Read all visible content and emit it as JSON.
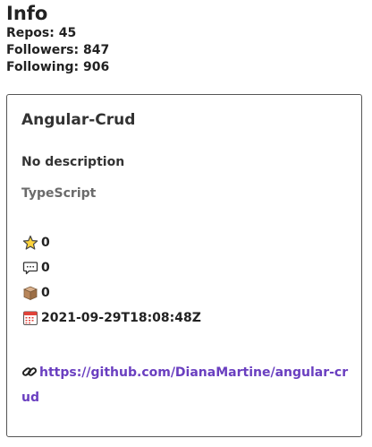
{
  "info": {
    "title": "Info",
    "repos": "Repos: 45",
    "followers": "Followers: 847",
    "following": "Following: 906"
  },
  "repo": {
    "name": "Angular-Crud",
    "description": "No description",
    "language": "TypeScript",
    "stars": "0",
    "comments": "0",
    "forks": "0",
    "updated": "2021-09-29T18:08:48Z",
    "url": "https://github.com/DianaMartine/angular-crud"
  },
  "icons": {
    "star": "star-icon",
    "comment": "speech-bubble-icon",
    "fork": "package-icon",
    "date": "calendar-icon",
    "link": "link-icon"
  },
  "colors": {
    "link": "#6a3fc0",
    "text": "#222222",
    "language": "#6b6b6b",
    "card_border": "#555555"
  }
}
